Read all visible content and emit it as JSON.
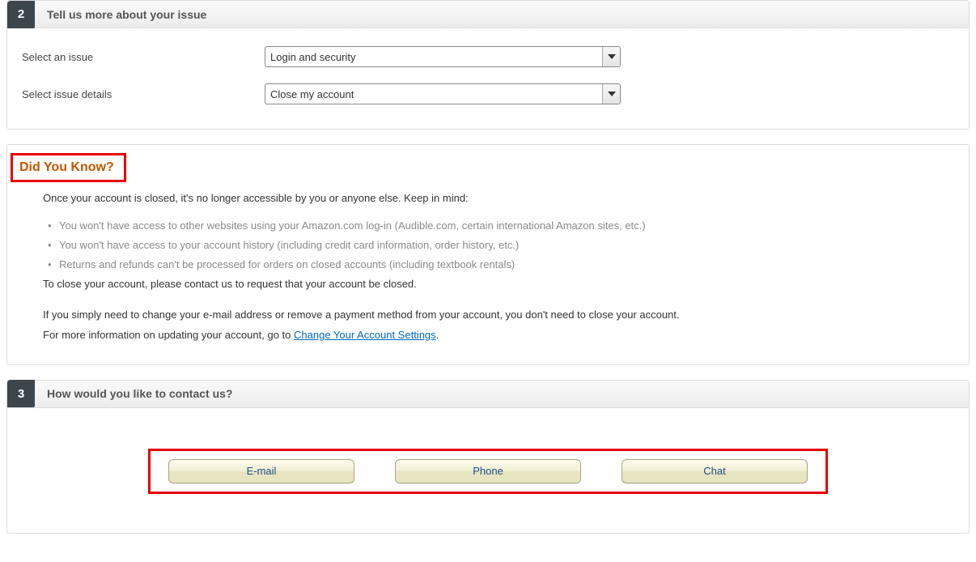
{
  "step2": {
    "number": "2",
    "title": "Tell us more about your issue",
    "issue_label": "Select an issue",
    "issue_value": "Login and security",
    "details_label": "Select issue details",
    "details_value": "Close my account"
  },
  "info": {
    "heading": "Did You Know?",
    "intro": "Once your account is closed, it's no longer accessible by you or anyone else. Keep in mind:",
    "bullets": [
      "You won't have access to other websites using your Amazon.com log-in (Audible.com, certain international Amazon sites, etc.)",
      "You won't have access to your account history (including credit card information, order history, etc.)",
      "Returns and refunds can't be processed for orders on closed accounts (including textbook rentals)"
    ],
    "close_line": "To close your account, please contact us to request that your account be closed.",
    "para2": "If you simply need to change your e-mail address or remove a payment method from your account, you don't need to close your account.",
    "para3_prefix": "For more information on updating your account, go to ",
    "link_text": "Change Your Account Settings",
    "para3_suffix": "."
  },
  "step3": {
    "number": "3",
    "title": "How would you like to contact us?",
    "email_label": "E-mail",
    "phone_label": "Phone",
    "chat_label": "Chat"
  }
}
